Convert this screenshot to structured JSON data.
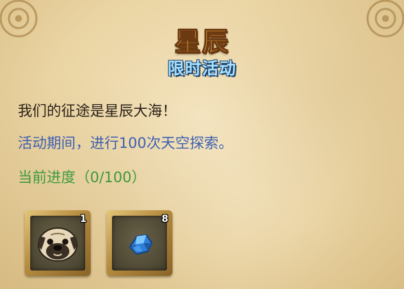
{
  "event": {
    "title": "星辰",
    "subtitle": "限时活动"
  },
  "description": {
    "line1": "我们的征途是星辰大海！",
    "line2": "活动期间，进行100次天空探索。"
  },
  "progress": {
    "label": "当前进度（0/100）",
    "current": 0,
    "total": 100
  },
  "rewards": [
    {
      "icon": "pug-dog-icon",
      "count": "1"
    },
    {
      "icon": "blue-crystal-icon",
      "count": "8"
    }
  ],
  "colors": {
    "title": "#f0a83a",
    "subtitle": "#a8e4ff",
    "body_text": "#2a2118",
    "info_text": "#3d5fb0",
    "progress_text": "#3d9a3d"
  }
}
